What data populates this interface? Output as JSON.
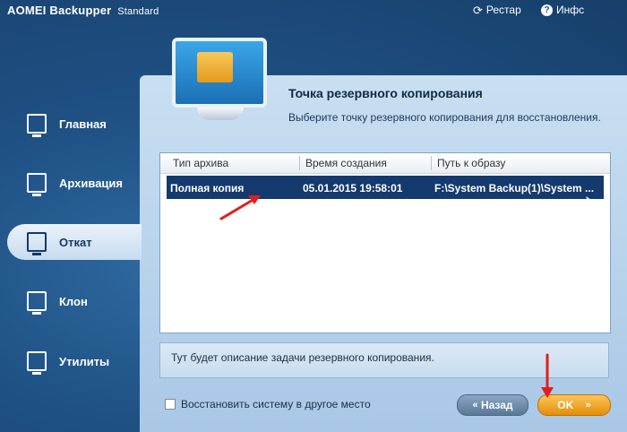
{
  "titlebar": {
    "app_name": "AOMEI Backupper",
    "edition": "Standard",
    "restart_label": "Рестар",
    "info_label": "Инфс"
  },
  "sidebar": {
    "items": [
      {
        "label": "Главная",
        "icon": "home-monitor-icon",
        "active": false
      },
      {
        "label": "Архивация",
        "icon": "backup-icon",
        "active": false
      },
      {
        "label": "Откат",
        "icon": "restore-icon",
        "active": true
      },
      {
        "label": "Клон",
        "icon": "clone-icon",
        "active": false
      },
      {
        "label": "Утилиты",
        "icon": "tools-icon",
        "active": false
      }
    ]
  },
  "main": {
    "title": "Точка резервного копирования",
    "subtitle": "Выберите точку резервного копирования для восстановления.",
    "table": {
      "columns": [
        "Тип архива",
        "Время создания",
        "Путь к образу"
      ],
      "rows": [
        {
          "type": "Полная копия",
          "time": "05.01.2015 19:58:01",
          "path": "F:\\System Backup(1)\\System ..."
        }
      ],
      "selected_row": 0
    },
    "description": "Тут будет описание задачи резервного копирования.",
    "restore_elsewhere_label": "Восстановить систему в другое место",
    "restore_elsewhere_checked": false,
    "back_label": "Назад",
    "ok_label": "OK"
  },
  "colors": {
    "background": "#1f5185",
    "selection": "#143a6e",
    "ok_button": "#e48d09",
    "annotation": "#e31d1d"
  }
}
